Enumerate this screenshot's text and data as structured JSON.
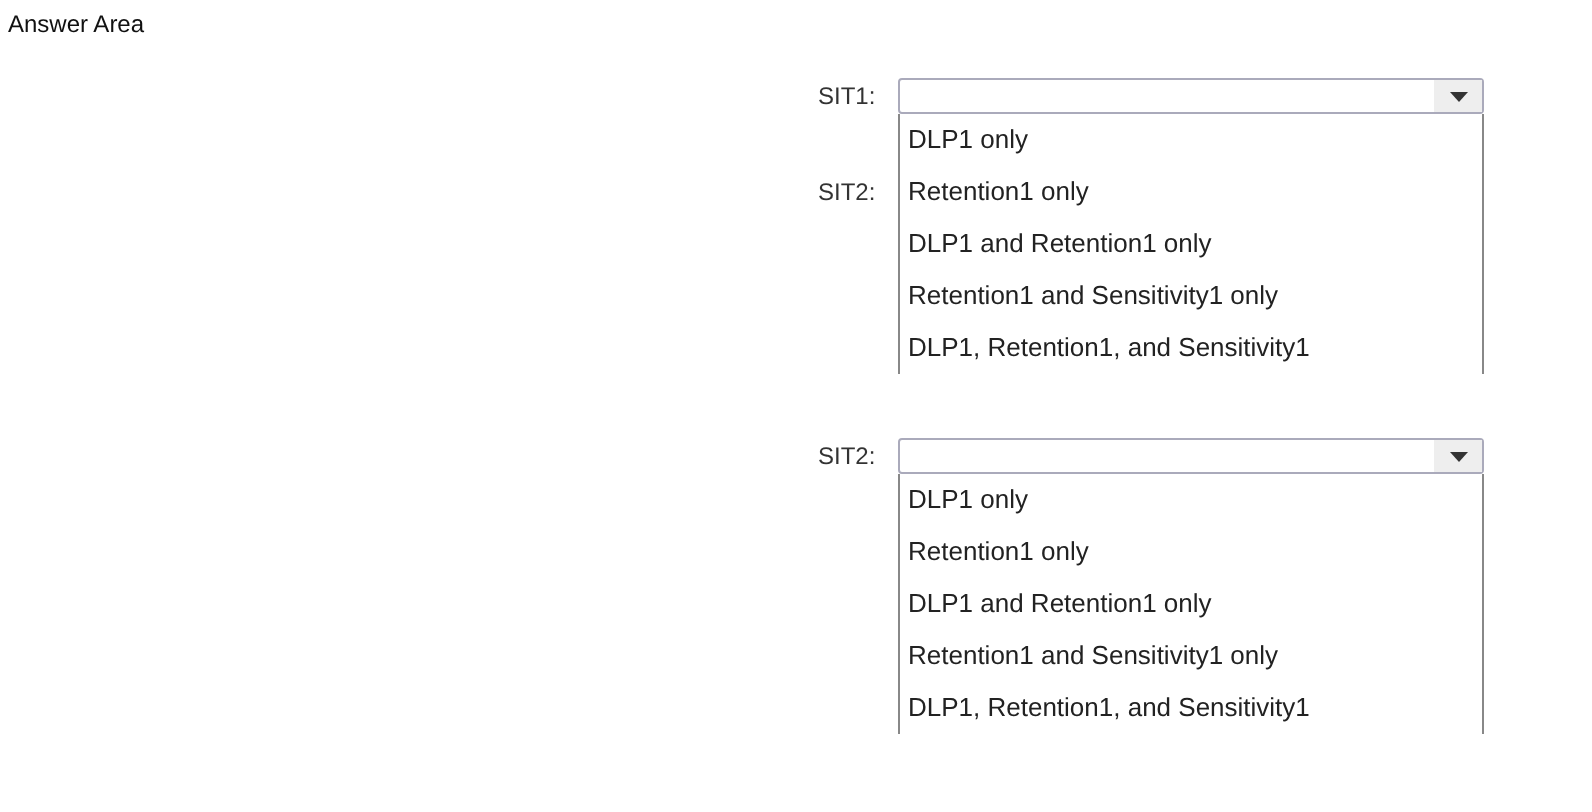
{
  "title": "Answer Area",
  "dropdowns": [
    {
      "label": "SIT1:",
      "options": [
        {
          "text": "DLP1 only"
        },
        {
          "text": "Retention1 only",
          "side_label": "SIT2:"
        },
        {
          "text": "DLP1 and Retention1 only"
        },
        {
          "text": "Retention1 and Sensitivity1 only"
        },
        {
          "text": "DLP1, Retention1, and Sensitivity1"
        }
      ]
    },
    {
      "label": "SIT2:",
      "options": [
        {
          "text": "DLP1 only"
        },
        {
          "text": "Retention1 only"
        },
        {
          "text": "DLP1 and Retention1 only"
        },
        {
          "text": "Retention1 and Sensitivity1 only"
        },
        {
          "text": "DLP1, Retention1, and Sensitivity1"
        }
      ]
    }
  ]
}
